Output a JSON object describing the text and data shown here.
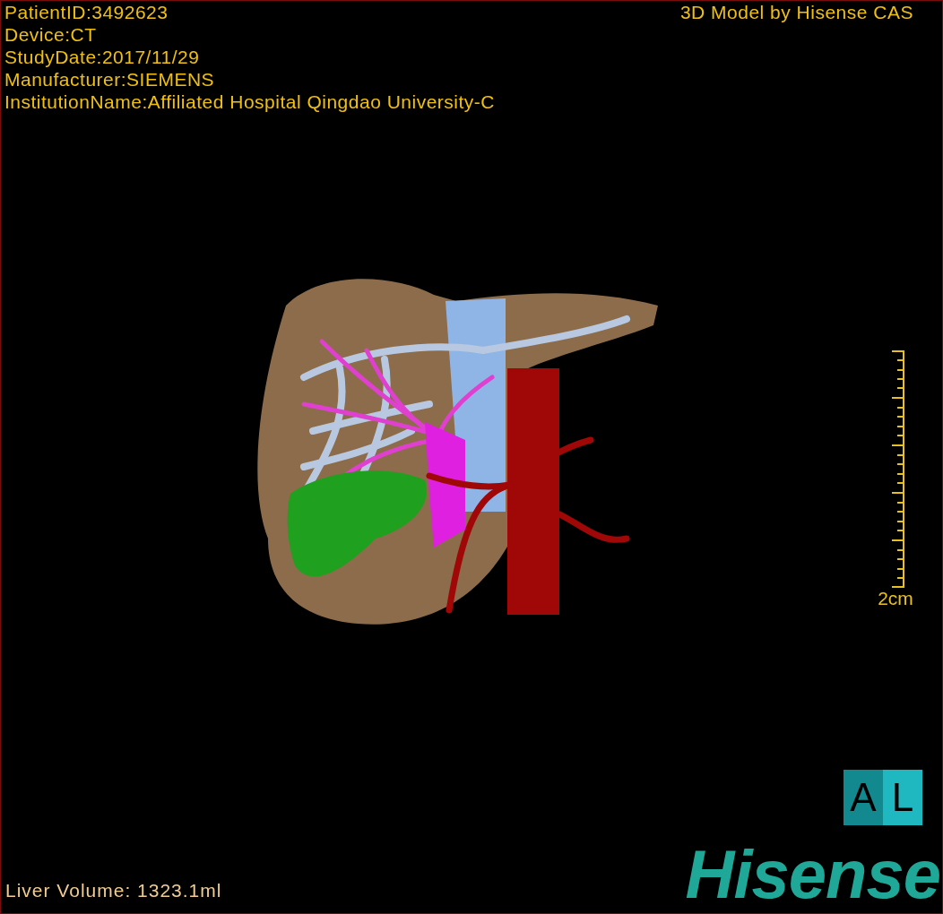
{
  "info_lines": [
    "PatientID:3492623",
    "Device:CT",
    "StudyDate:2017/11/29",
    "Manufacturer:SIEMENS",
    "InstitutionName:Affiliated Hospital Qingdao University-C"
  ],
  "title": "3D Model by Hisense CAS",
  "scale_label": "2cm",
  "orientation_labels": [
    "A",
    "L"
  ],
  "volume": "Liver Volume: 1323.1ml",
  "logo": "Hisense"
}
